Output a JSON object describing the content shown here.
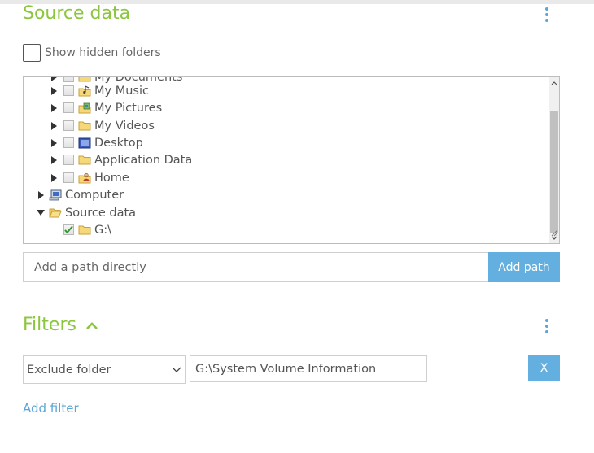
{
  "source": {
    "title": "Source data",
    "show_hidden_label": "Show hidden folders",
    "tree": [
      {
        "label": "My Documents",
        "icon": "folder-icon",
        "expander": "collapsed",
        "checkbox": "unchecked"
      },
      {
        "label": "My Music",
        "icon": "music-folder-icon",
        "expander": "collapsed",
        "checkbox": "unchecked"
      },
      {
        "label": "My Pictures",
        "icon": "pictures-folder-icon",
        "expander": "collapsed",
        "checkbox": "unchecked"
      },
      {
        "label": "My Videos",
        "icon": "folder-icon",
        "expander": "collapsed",
        "checkbox": "unchecked"
      },
      {
        "label": "Desktop",
        "icon": "desktop-icon",
        "expander": "collapsed",
        "checkbox": "unchecked"
      },
      {
        "label": "Application Data",
        "icon": "folder-icon",
        "expander": "collapsed",
        "checkbox": "unchecked"
      },
      {
        "label": "Home",
        "icon": "user-folder-icon",
        "expander": "collapsed",
        "checkbox": "unchecked"
      },
      {
        "label": "Computer",
        "icon": "computer-icon",
        "expander": "collapsed"
      },
      {
        "label": "Source data",
        "icon": "open-folder-icon",
        "expander": "expanded"
      },
      {
        "label": "G:\\",
        "icon": "folder-icon",
        "checkbox": "checked"
      }
    ],
    "path_placeholder": "Add a path directly",
    "add_path_label": "Add path"
  },
  "filters": {
    "title": "Filters",
    "rule_type": "Exclude folder",
    "rule_value": "G:\\System Volume Information",
    "remove_label": "X",
    "add_filter_label": "Add filter"
  },
  "colors": {
    "accent_green": "#8cc63f",
    "accent_blue": "#63b0e0",
    "link_blue": "#5aa6d6"
  }
}
